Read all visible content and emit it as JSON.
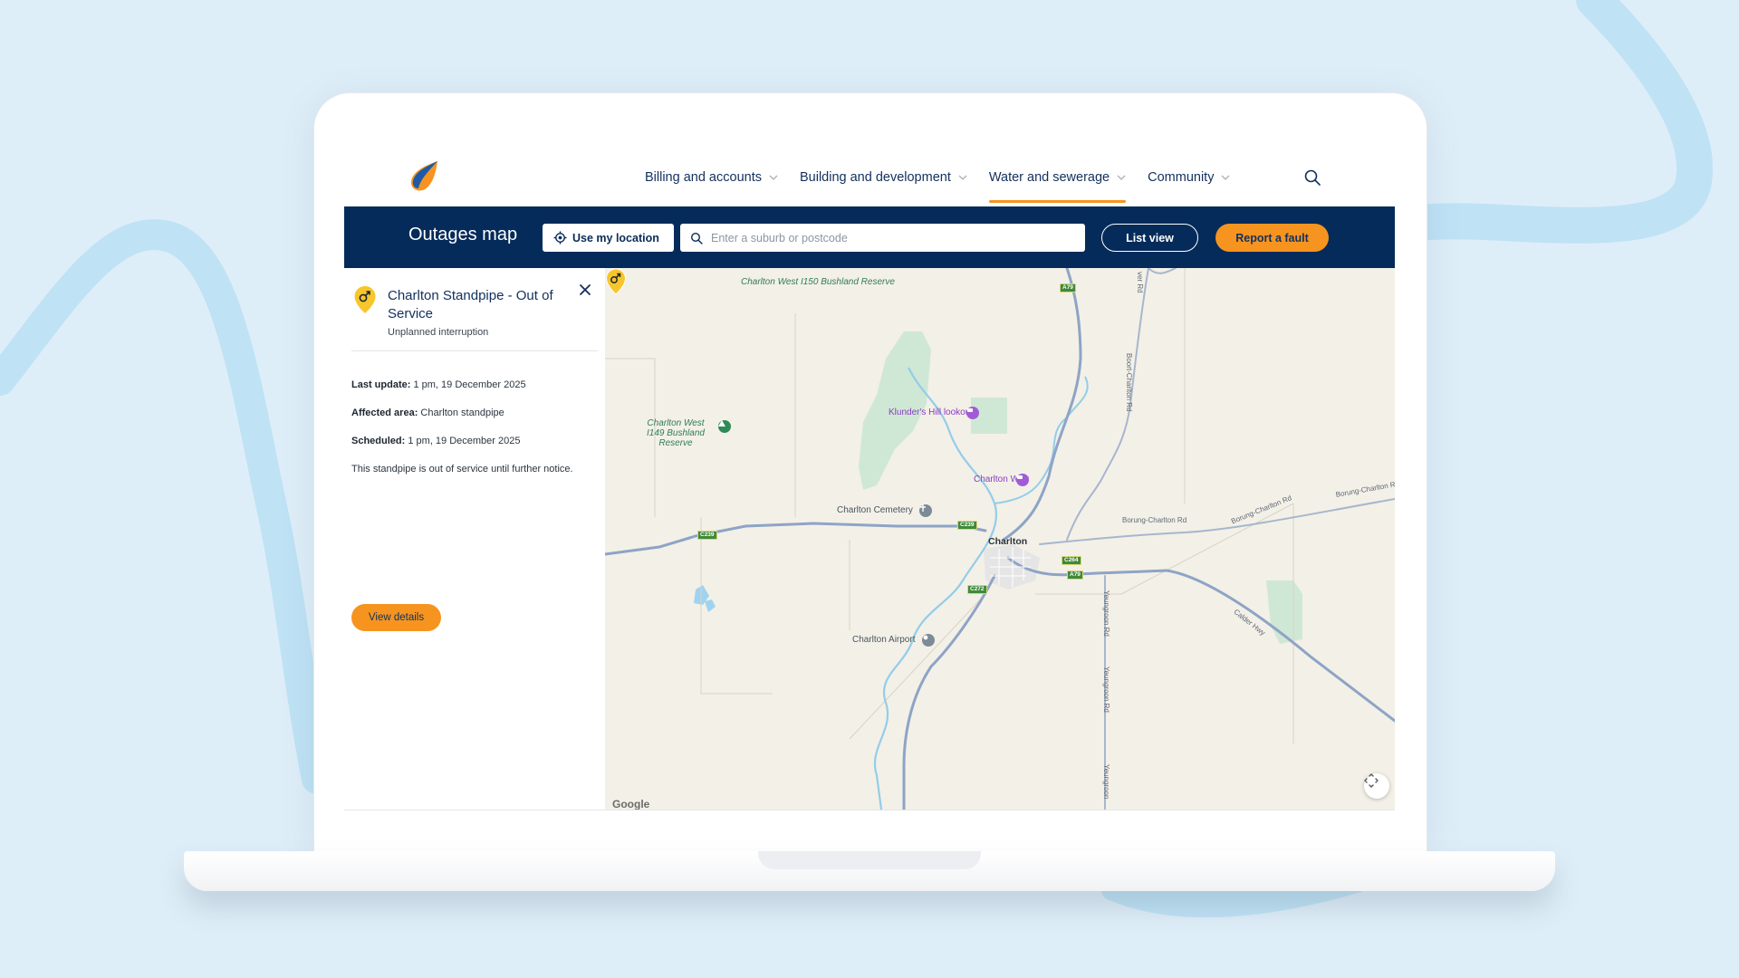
{
  "brand": {
    "accent": "#f6941f",
    "navy": "#042b5a",
    "text_navy": "#12305d",
    "logo_icon": "water-drop-logo-icon"
  },
  "nav": {
    "items": [
      {
        "label": "Billing and accounts",
        "active": false
      },
      {
        "label": "Building and development",
        "active": false
      },
      {
        "label": "Water and sewerage",
        "active": true
      },
      {
        "label": "Community",
        "active": false
      }
    ],
    "search_icon": "search-icon"
  },
  "toolbar": {
    "title": "Outages map",
    "location_button": "Use my location",
    "search_placeholder": "Enter a suburb or postcode",
    "list_view_button": "List view",
    "report_fault_button": "Report a fault"
  },
  "outage": {
    "title": "Charlton Standpipe - Out of Service",
    "type": "Unplanned interruption",
    "last_update_label": "Last update:",
    "last_update_value": "1 pm, 19 December 2025",
    "affected_area_label": "Affected area:",
    "affected_area_value": "Charlton standpipe",
    "scheduled_label": "Scheduled:",
    "scheduled_value": "1 pm, 19 December 2025",
    "description": "This standpipe is out of service until further notice.",
    "details_button": "View details"
  },
  "map": {
    "labels": {
      "reserve_1": "Charlton West I150 Bushland Reserve",
      "reserve_2": "Charlton West I149 Bushland Reserve",
      "lookout": "Klunder's Hill lookout",
      "weir": "Charlton Weir",
      "cemetery": "Charlton Cemetery",
      "town": "Charlton",
      "airport": "Charlton Airport"
    },
    "roads": {
      "boort": "Boort-Charlton Rd",
      "borung_1": "Borung-Charlton Rd",
      "borung_2": "Borung-Charlton Rd",
      "borung_3": "Borung-Charlton R",
      "calder": "Calder Hwy",
      "yeungroon_1": "Yeungroon Rd",
      "yeungroon_2": "Yeungroon Rd",
      "yeungroon_3": "Yeungroon",
      "top": "ver Rd"
    },
    "shields": {
      "a79_top": "A79",
      "a79_east": "A79",
      "c239_west": "C239",
      "c239_town": "C239",
      "c272": "C272",
      "c264": "C264"
    },
    "attribution": "Google"
  }
}
